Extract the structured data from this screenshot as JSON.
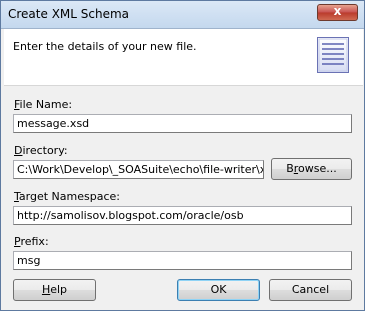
{
  "window": {
    "title": "Create XML Schema",
    "close_glyph": "x"
  },
  "header": {
    "text": "Enter the details of your new file.",
    "icon": "document-icon"
  },
  "fields": {
    "file_name": {
      "label_mnemonic": "F",
      "label_rest": "ile Name:",
      "value": "message.xsd"
    },
    "directory": {
      "label_mnemonic": "D",
      "label_rest": "irectory:",
      "value": "C:\\Work\\Develop\\_SOASuite\\echo\\file-writer\\xsd"
    },
    "target_namespace": {
      "label_mnemonic": "T",
      "label_rest": "arget Namespace:",
      "value": "http://samolisov.blogspot.com/oracle/osb"
    },
    "prefix": {
      "label_mnemonic": "P",
      "label_rest": "refix:",
      "value": "msg"
    }
  },
  "buttons": {
    "browse_pre": "B",
    "browse_mnemonic": "r",
    "browse_post": "owse...",
    "help_mnemonic": "H",
    "help_rest": "elp",
    "ok": "OK",
    "cancel": "Cancel"
  }
}
